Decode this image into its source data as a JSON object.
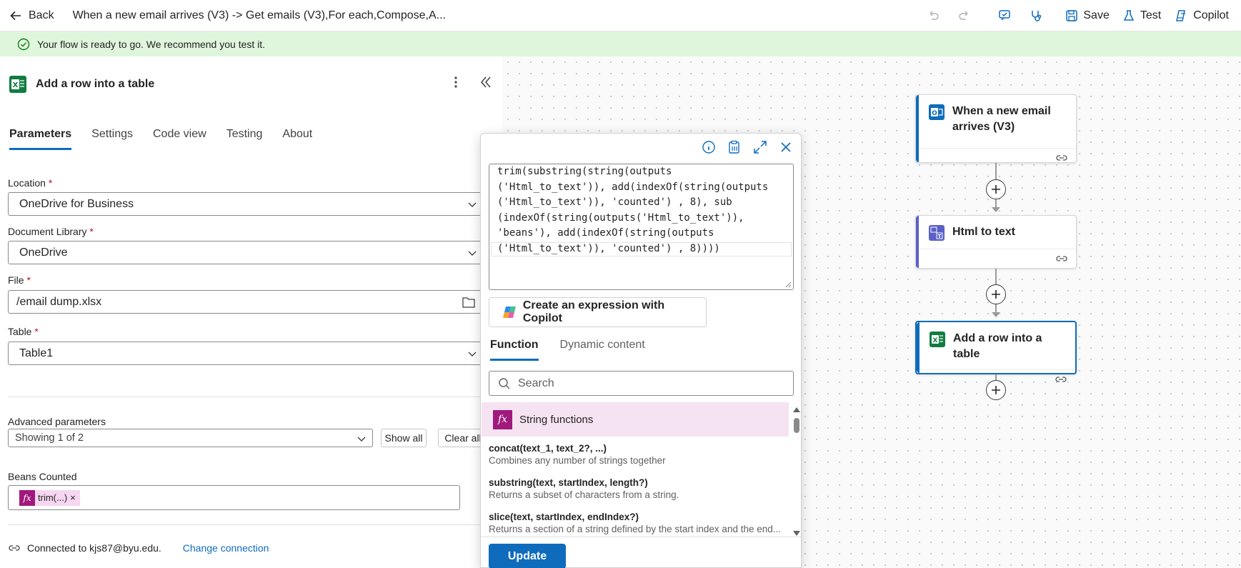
{
  "topbar": {
    "back_label": "Back",
    "flow_title": "When a new email arrives (V3) -> Get emails (V3),For each,Compose,A...",
    "save_label": "Save",
    "test_label": "Test",
    "copilot_label": "Copilot"
  },
  "banner": {
    "message": "Your flow is ready to go. We recommend you test it."
  },
  "panel": {
    "title": "Add a row into a table",
    "tabs": [
      "Parameters",
      "Settings",
      "Code view",
      "Testing",
      "About"
    ],
    "active_tab": "Parameters",
    "fields": {
      "location": {
        "label": "Location",
        "value": "OneDrive for Business"
      },
      "document_library": {
        "label": "Document Library",
        "value": "OneDrive"
      },
      "file": {
        "label": "File",
        "value": "/email dump.xlsx"
      },
      "table": {
        "label": "Table",
        "value": "Table1"
      }
    },
    "required_marker": "*",
    "advanced": {
      "label": "Advanced parameters",
      "value": "Showing 1 of 2",
      "show_all": "Show all",
      "clear_all": "Clear all"
    },
    "beans": {
      "label": "Beans Counted",
      "token": "trim(...)",
      "token_remove": "×",
      "fx": "fx"
    },
    "connection": {
      "text": "Connected to kjs87@byu.edu.",
      "change": "Change connection"
    }
  },
  "expression": {
    "lines": [
      "trim(substring(string(outputs",
      "('Html_to_text')), add(indexOf(string(outputs",
      "('Html_to_text')), 'counted') , 8), sub",
      "(indexOf(string(outputs('Html_to_text')),",
      "'beans'), add(indexOf(string(outputs",
      "('Html_to_text')), 'counted') , 8))))"
    ],
    "copilot_button": "Create an expression with Copilot",
    "tabs": [
      "Function",
      "Dynamic content"
    ],
    "active_tab": "Function",
    "search_placeholder": "Search",
    "category": "String functions",
    "functions": [
      {
        "name": "concat(text_1, text_2?, ...)",
        "desc": "Combines any number of strings together"
      },
      {
        "name": "substring(text, startIndex, length?)",
        "desc": "Returns a subset of characters from a string."
      },
      {
        "name": "slice(text, startIndex, endIndex?)",
        "desc": "Returns a section of a string defined by the start index and the end..."
      }
    ],
    "update_button": "Update"
  },
  "flow": {
    "nodes": [
      {
        "title": "When a new email arrives (V3)",
        "accent": "#0f6cbd"
      },
      {
        "title": "Html to text",
        "accent": "#5b5fc7"
      },
      {
        "title": "Add a row into a table",
        "accent": "#0f6cbd"
      }
    ]
  },
  "colors": {
    "accent": "#0f6cbd",
    "banner_bg": "#dff6dd",
    "banner_check": "#107c10",
    "fx_token": "#a0197d",
    "excel_green": "#107c41"
  }
}
